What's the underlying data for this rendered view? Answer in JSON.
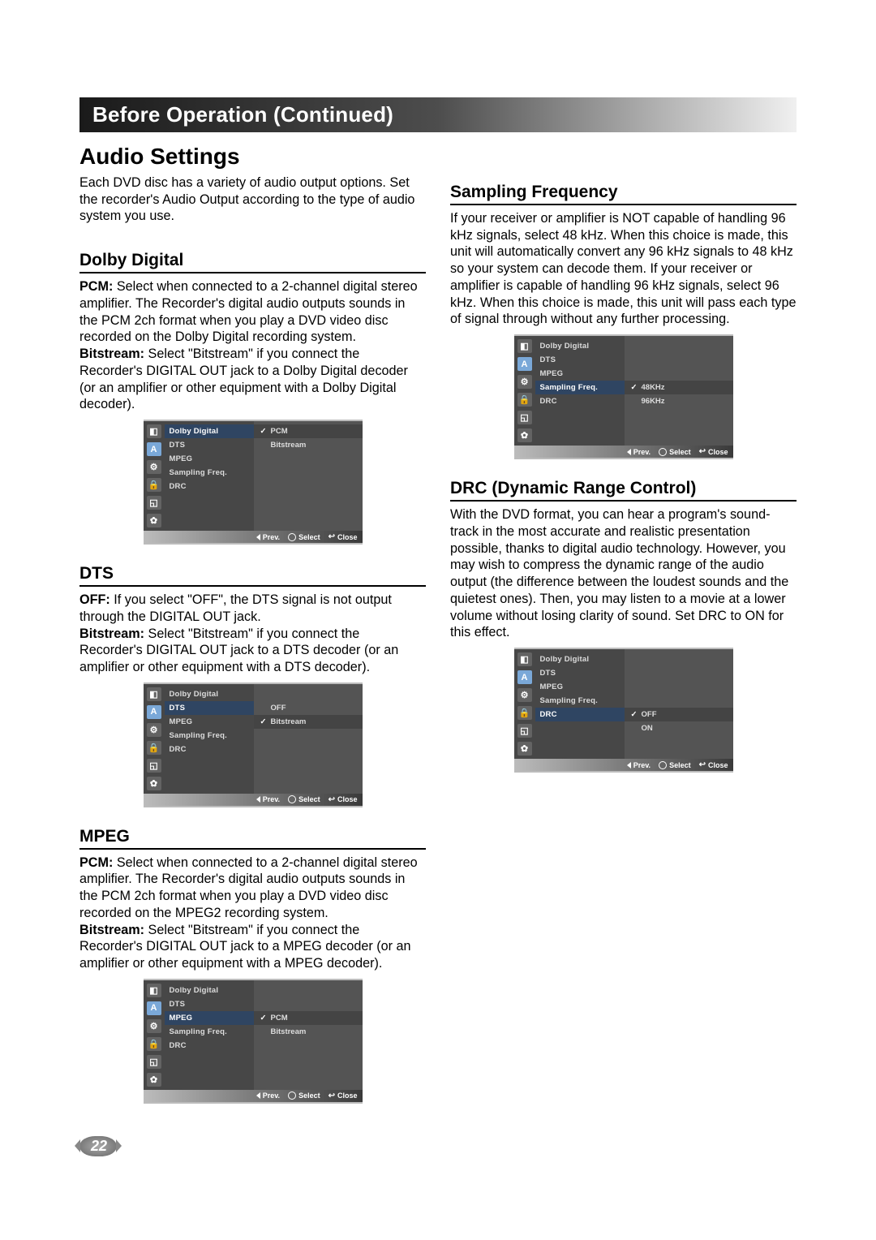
{
  "banner": "Before Operation (Continued)",
  "title": "Audio Settings",
  "intro": "Each DVD disc has a variety of audio output options. Set the recorder's Audio Output according to the type of audio system you use.",
  "page_number": "22",
  "sections": {
    "dolby": {
      "heading": "Dolby Digital",
      "pcm_label": "PCM:",
      "pcm_text": " Select when connected to a 2-channel digital stereo amplifier. The Recorder's digital audio outputs sounds in the PCM 2ch format when you play a DVD video disc recorded on the Dolby Digital recording system.",
      "bs_label": "Bitstream:",
      "bs_text": " Select \"Bitstream\" if you connect the Recorder's DIGITAL OUT jack to a Dolby Digital decoder (or an amplifier or other equipment with a Dolby Digital decoder)."
    },
    "dts": {
      "heading": "DTS",
      "off_label": "OFF:",
      "off_text": " If you select \"OFF\", the DTS signal is not output through the DIGITAL OUT jack.",
      "bs_label": "Bitstream:",
      "bs_text": " Select \"Bitstream\" if you connect the Recorder's DIGITAL OUT jack to a DTS decoder (or an amplifier or other equipment with a DTS decoder)."
    },
    "mpeg": {
      "heading": "MPEG",
      "pcm_label": "PCM:",
      "pcm_text": " Select when connected to a 2-channel digital stereo amplifier. The Recorder's digital audio outputs sounds in the PCM 2ch format when you play a DVD video disc recorded on the MPEG2 recording system.",
      "bs_label": "Bitstream:",
      "bs_text": " Select \"Bitstream\" if you connect the Recorder's DIGITAL OUT jack to a MPEG decoder (or an amplifier or other equipment with a MPEG decoder)."
    },
    "sampling": {
      "heading": "Sampling Frequency",
      "text": "If your receiver or amplifier is NOT capable of handling 96 kHz signals, select 48 kHz. When this choice is made, this unit will automatically convert any 96 kHz signals to 48 kHz so your system can decode them. If your receiver or amplifier is capable of handling 96 kHz signals, select 96 kHz. When this choice is made, this unit will pass each type of signal through without any further processing."
    },
    "drc": {
      "heading": "DRC (Dynamic Range Control)",
      "text": "With the DVD format, you can hear a program's sound-track in the most accurate and realistic presentation possible, thanks to digital audio technology. However, you may wish to compress the dynamic range of the audio output (the difference between the loudest sounds and the quietest ones). Then, you may listen to a movie at a lower volume without losing clarity of sound. Set DRC to ON for this effect."
    }
  },
  "menu": {
    "items": [
      "Dolby Digital",
      "DTS",
      "MPEG",
      "Sampling Freq.",
      "DRC"
    ],
    "footer": {
      "prev": "Prev.",
      "select": "Select",
      "close": "Close"
    },
    "dolby": {
      "hl": 0,
      "vals": [
        "PCM",
        "Bitstream"
      ],
      "checked": 0
    },
    "dts": {
      "hl": 1,
      "vals": [
        "OFF",
        "Bitstream"
      ],
      "checked": 1
    },
    "mpeg": {
      "hl": 2,
      "vals": [
        "PCM",
        "Bitstream"
      ],
      "checked": 0
    },
    "sampling": {
      "hl": 3,
      "vals": [
        "48KHz",
        "96KHz"
      ],
      "checked": 0
    },
    "drc": {
      "hl": 4,
      "vals": [
        "OFF",
        "ON"
      ],
      "checked": 0
    }
  },
  "icons": [
    "◧",
    "A",
    "⚙",
    "🔒",
    "◱",
    "✿"
  ]
}
